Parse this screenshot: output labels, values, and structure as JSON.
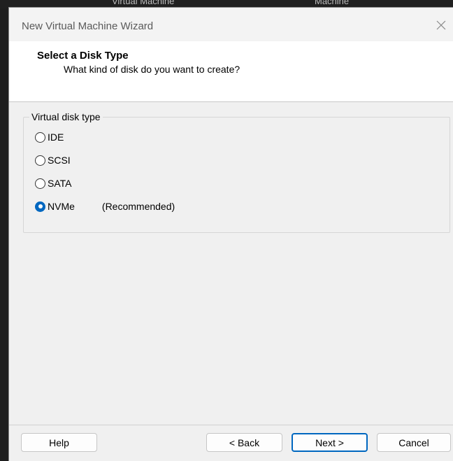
{
  "background": {
    "text_left": "Virtual Machine",
    "text_right": "Machine"
  },
  "window": {
    "title": "New Virtual Machine Wizard"
  },
  "header": {
    "title": "Select a Disk Type",
    "subtitle": "What kind of disk do you want to create?"
  },
  "disk_type": {
    "group_label": "Virtual disk type",
    "options": [
      {
        "label": "IDE",
        "checked": false
      },
      {
        "label": "SCSI",
        "checked": false
      },
      {
        "label": "SATA",
        "checked": false
      },
      {
        "label": "NVMe",
        "checked": true,
        "note": "(Recommended)"
      }
    ]
  },
  "buttons": {
    "help": "Help",
    "back": "< Back",
    "next": "Next >",
    "cancel": "Cancel"
  },
  "colors": {
    "accent": "#0067c0",
    "dialog_bg": "#f0f0f0",
    "header_bg": "#ffffff"
  },
  "icons": {
    "close": "close-icon"
  }
}
